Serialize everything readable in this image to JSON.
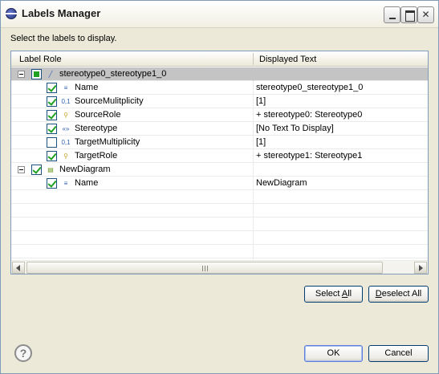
{
  "window": {
    "title": "Labels Manager",
    "controls": {
      "minimize": "_",
      "maximize": "□",
      "close": "✕"
    }
  },
  "instruction": "Select the labels to display.",
  "table": {
    "columns": [
      "Label Role",
      "Displayed Text"
    ],
    "rows": [
      {
        "level": 0,
        "expander": "minus",
        "check": "partial",
        "icon": "connector-icon",
        "label": "stereotype0_stereotype1_0",
        "text": "",
        "selected": true
      },
      {
        "level": 1,
        "check": "checked",
        "icon": "name-label-icon",
        "label": "Name",
        "text": "stereotype0_stereotype1_0"
      },
      {
        "level": 1,
        "check": "checked",
        "icon": "multiplicity-icon",
        "label": "SourceMulitplicity",
        "text": "[1]"
      },
      {
        "level": 1,
        "check": "checked",
        "icon": "role-icon",
        "label": "SourceRole",
        "text": "+ stereotype0: Stereotype0"
      },
      {
        "level": 1,
        "check": "checked",
        "icon": "stereotype-icon",
        "label": "Stereotype",
        "text": "[No Text To Display]"
      },
      {
        "level": 1,
        "check": "unchecked",
        "icon": "multiplicity-icon",
        "label": "TargetMultiplicity",
        "text": "[1]"
      },
      {
        "level": 1,
        "check": "checked",
        "icon": "role-icon",
        "label": "TargetRole",
        "text": "+ stereotype1: Stereotype1"
      },
      {
        "level": 0,
        "expander": "minus",
        "check": "checked",
        "icon": "diagram-icon",
        "label": "NewDiagram",
        "text": ""
      },
      {
        "level": 1,
        "check": "checked",
        "icon": "name-label-icon",
        "label": "Name",
        "text": "NewDiagram"
      }
    ],
    "empty_rows": 6
  },
  "buttons": {
    "select_all": {
      "prefix": "Select ",
      "mnemonic": "A",
      "suffix": "ll"
    },
    "deselect_all": {
      "prefix": "",
      "mnemonic": "D",
      "suffix": "eselect All"
    },
    "ok": "OK",
    "cancel": "Cancel"
  },
  "help": "?",
  "colors": {
    "check": "#21a121",
    "selected_row": "#c4c4c4",
    "border": "#7f9db9"
  }
}
